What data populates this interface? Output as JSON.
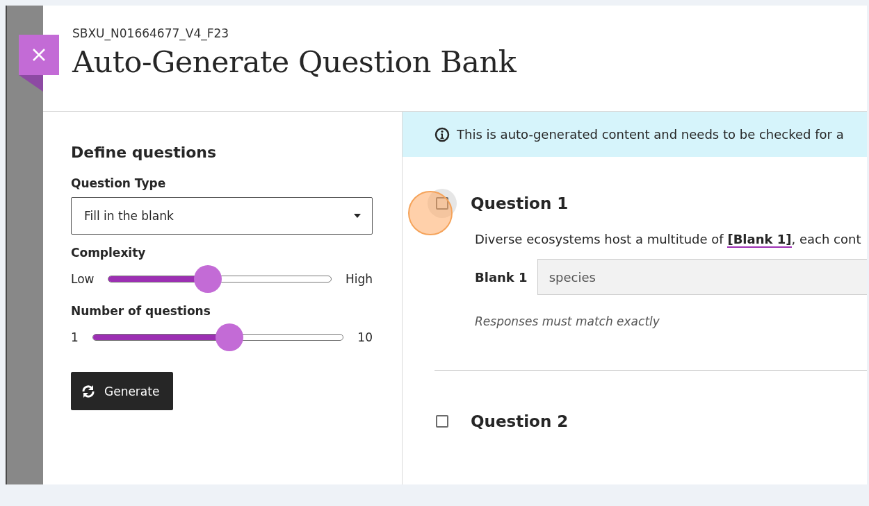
{
  "header": {
    "subtitle": "SBXU_N01664677_V4_F23",
    "title": "Auto-Generate Question Bank"
  },
  "form": {
    "heading": "Define questions",
    "question_type": {
      "label": "Question Type",
      "value": "Fill in the blank"
    },
    "sliders": [
      {
        "label": "Complexity",
        "min_label": "Low",
        "max_label": "High",
        "level": 0.44
      },
      {
        "label": "Number of questions",
        "min_label": "1",
        "max_label": "10",
        "level": 0.55
      }
    ],
    "generate_button": "Generate"
  },
  "notice": "This is auto-generated content and needs to be checked for a",
  "questions": [
    {
      "title": "Question 1",
      "checked": false,
      "focused": true,
      "text": "Diverse ecosystems host a multitude of **[Blank 1]**, each cont",
      "blanks": [
        {
          "label": "Blank 1",
          "value": "species"
        }
      ],
      "note": "Responses must match exactly"
    },
    {
      "title": "Question 2",
      "checked": false,
      "focused": false
    }
  ]
}
